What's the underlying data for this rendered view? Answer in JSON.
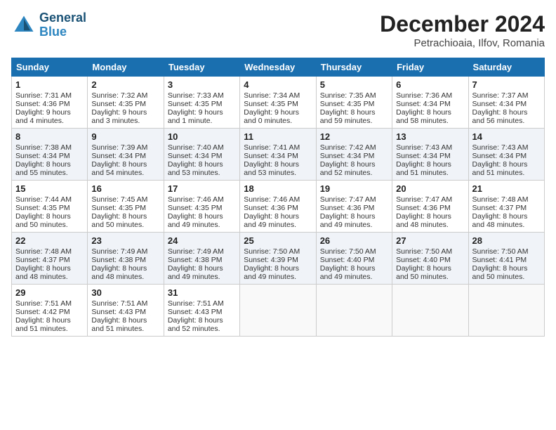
{
  "header": {
    "logo_line1": "General",
    "logo_line2": "Blue",
    "title": "December 2024",
    "subtitle": "Petrachioaia, Ilfov, Romania"
  },
  "weekdays": [
    "Sunday",
    "Monday",
    "Tuesday",
    "Wednesday",
    "Thursday",
    "Friday",
    "Saturday"
  ],
  "weeks": [
    [
      {
        "day": "1",
        "sr": "7:31 AM",
        "ss": "4:36 PM",
        "dl": "9 hours and 4 minutes."
      },
      {
        "day": "2",
        "sr": "7:32 AM",
        "ss": "4:35 PM",
        "dl": "9 hours and 3 minutes."
      },
      {
        "day": "3",
        "sr": "7:33 AM",
        "ss": "4:35 PM",
        "dl": "9 hours and 1 minute."
      },
      {
        "day": "4",
        "sr": "7:34 AM",
        "ss": "4:35 PM",
        "dl": "9 hours and 0 minutes."
      },
      {
        "day": "5",
        "sr": "7:35 AM",
        "ss": "4:35 PM",
        "dl": "8 hours and 59 minutes."
      },
      {
        "day": "6",
        "sr": "7:36 AM",
        "ss": "4:34 PM",
        "dl": "8 hours and 58 minutes."
      },
      {
        "day": "7",
        "sr": "7:37 AM",
        "ss": "4:34 PM",
        "dl": "8 hours and 56 minutes."
      }
    ],
    [
      {
        "day": "8",
        "sr": "7:38 AM",
        "ss": "4:34 PM",
        "dl": "8 hours and 55 minutes."
      },
      {
        "day": "9",
        "sr": "7:39 AM",
        "ss": "4:34 PM",
        "dl": "8 hours and 54 minutes."
      },
      {
        "day": "10",
        "sr": "7:40 AM",
        "ss": "4:34 PM",
        "dl": "8 hours and 53 minutes."
      },
      {
        "day": "11",
        "sr": "7:41 AM",
        "ss": "4:34 PM",
        "dl": "8 hours and 53 minutes."
      },
      {
        "day": "12",
        "sr": "7:42 AM",
        "ss": "4:34 PM",
        "dl": "8 hours and 52 minutes."
      },
      {
        "day": "13",
        "sr": "7:43 AM",
        "ss": "4:34 PM",
        "dl": "8 hours and 51 minutes."
      },
      {
        "day": "14",
        "sr": "7:43 AM",
        "ss": "4:34 PM",
        "dl": "8 hours and 51 minutes."
      }
    ],
    [
      {
        "day": "15",
        "sr": "7:44 AM",
        "ss": "4:35 PM",
        "dl": "8 hours and 50 minutes."
      },
      {
        "day": "16",
        "sr": "7:45 AM",
        "ss": "4:35 PM",
        "dl": "8 hours and 50 minutes."
      },
      {
        "day": "17",
        "sr": "7:46 AM",
        "ss": "4:35 PM",
        "dl": "8 hours and 49 minutes."
      },
      {
        "day": "18",
        "sr": "7:46 AM",
        "ss": "4:36 PM",
        "dl": "8 hours and 49 minutes."
      },
      {
        "day": "19",
        "sr": "7:47 AM",
        "ss": "4:36 PM",
        "dl": "8 hours and 49 minutes."
      },
      {
        "day": "20",
        "sr": "7:47 AM",
        "ss": "4:36 PM",
        "dl": "8 hours and 48 minutes."
      },
      {
        "day": "21",
        "sr": "7:48 AM",
        "ss": "4:37 PM",
        "dl": "8 hours and 48 minutes."
      }
    ],
    [
      {
        "day": "22",
        "sr": "7:48 AM",
        "ss": "4:37 PM",
        "dl": "8 hours and 48 minutes."
      },
      {
        "day": "23",
        "sr": "7:49 AM",
        "ss": "4:38 PM",
        "dl": "8 hours and 48 minutes."
      },
      {
        "day": "24",
        "sr": "7:49 AM",
        "ss": "4:38 PM",
        "dl": "8 hours and 49 minutes."
      },
      {
        "day": "25",
        "sr": "7:50 AM",
        "ss": "4:39 PM",
        "dl": "8 hours and 49 minutes."
      },
      {
        "day": "26",
        "sr": "7:50 AM",
        "ss": "4:40 PM",
        "dl": "8 hours and 49 minutes."
      },
      {
        "day": "27",
        "sr": "7:50 AM",
        "ss": "4:40 PM",
        "dl": "8 hours and 50 minutes."
      },
      {
        "day": "28",
        "sr": "7:50 AM",
        "ss": "4:41 PM",
        "dl": "8 hours and 50 minutes."
      }
    ],
    [
      {
        "day": "29",
        "sr": "7:51 AM",
        "ss": "4:42 PM",
        "dl": "8 hours and 51 minutes."
      },
      {
        "day": "30",
        "sr": "7:51 AM",
        "ss": "4:43 PM",
        "dl": "8 hours and 51 minutes."
      },
      {
        "day": "31",
        "sr": "7:51 AM",
        "ss": "4:43 PM",
        "dl": "8 hours and 52 minutes."
      },
      null,
      null,
      null,
      null
    ]
  ]
}
